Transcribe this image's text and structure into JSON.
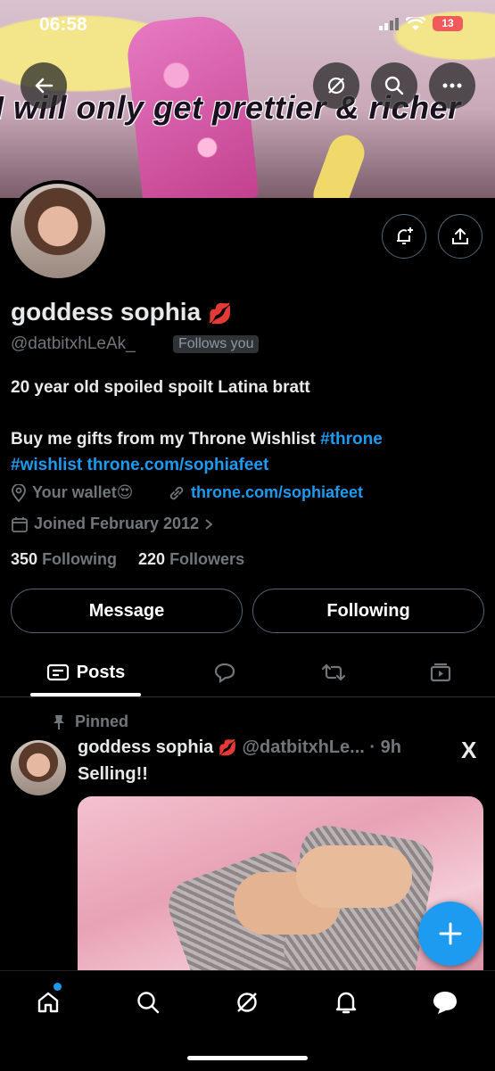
{
  "status_bar": {
    "time": "06:58",
    "battery": "13"
  },
  "banner": {
    "caption": "I will only get prettier & richer"
  },
  "profile": {
    "name": "goddess sophia",
    "name_emoji": "💋",
    "handle": "@datbitxhLeAk_",
    "follows_you": "Follows you",
    "bio_line1": "20 year old spoiled spoilt Latina bratt",
    "bio_line2_text": "Buy me gifts from my Throne Wishlist ",
    "bio_hashtag1": "#throne",
    "bio_hashtag2": "#wishlist",
    "bio_link": "throne.com/sophiafeet",
    "location": "Your wallet😍",
    "website": "throne.com/sophiafeet",
    "joined": "Joined February 2012",
    "following_count": "350",
    "following_label": "Following",
    "followers_count": "220",
    "followers_label": "Followers"
  },
  "actions": {
    "message": "Message",
    "following": "Following"
  },
  "tabs": {
    "posts": "Posts"
  },
  "post": {
    "pinned_label": "Pinned",
    "author": "goddess sophia",
    "author_emoji": "💋",
    "handle": "@datbitxhLe...",
    "time": "· 9h",
    "text": "Selling!!",
    "brand": "X"
  },
  "colors": {
    "accent": "#1d9bf0",
    "background": "#000000",
    "muted": "#71767b"
  }
}
